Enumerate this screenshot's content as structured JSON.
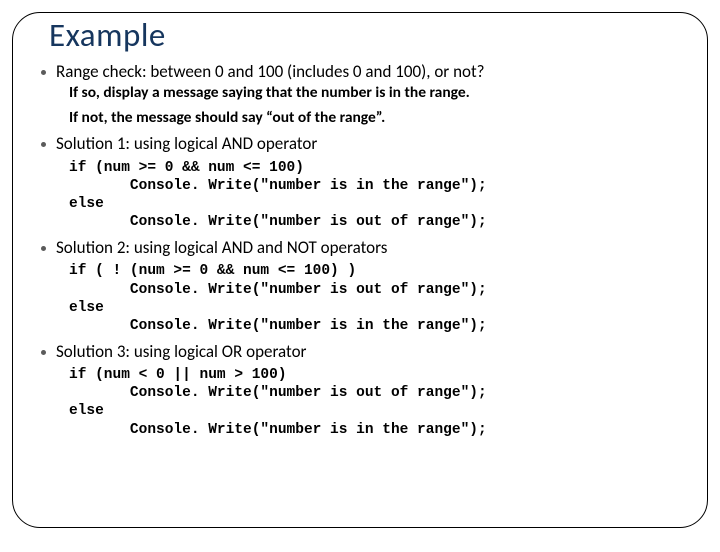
{
  "title": "Example",
  "b1": {
    "text": "Range check: between 0 and 100 (includes 0 and 100), or not?",
    "sub1": "If so, display a message saying that the number is in the range.",
    "sub2": "If not, the message should say “out of the range”."
  },
  "b2": {
    "text": "Solution 1: using logical AND operator",
    "code": "if (num >= 0 && num <= 100)\n       Console. Write(\"number is in the range\");\nelse\n       Console. Write(\"number is out of range\");"
  },
  "b3": {
    "text": "Solution 2: using logical AND and NOT operators",
    "code": "if ( ! (num >= 0 && num <= 100) )\n       Console. Write(\"number is out of range\");\nelse\n       Console. Write(\"number is in the range\");"
  },
  "b4": {
    "text": "Solution 3: using logical OR operator",
    "code": "if (num < 0 || num > 100)\n       Console. Write(\"number is out of range\");\nelse\n       Console. Write(\"number is in the range\");"
  }
}
